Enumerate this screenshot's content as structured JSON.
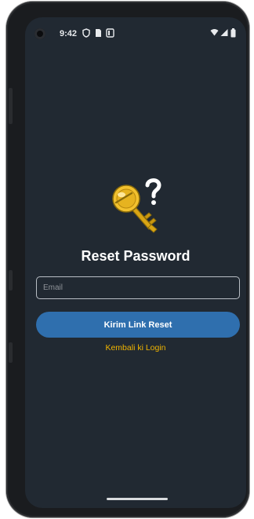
{
  "status_bar": {
    "time": "9:42"
  },
  "reset_form": {
    "title": "Reset Password",
    "email_placeholder": "Email",
    "email_value": "",
    "submit_label": "Kirim Link Reset",
    "back_link": "Kembali ki Login"
  },
  "colors": {
    "background": "#212932",
    "primary_button": "#2f6fae",
    "link": "#f0b400",
    "title_text": "#ffffff"
  },
  "icons": {
    "status_left": [
      "vpn-icon",
      "sim-icon",
      "screen-cast-icon"
    ],
    "status_right": [
      "wifi-icon",
      "signal-icon",
      "battery-icon"
    ],
    "hero": "key-question-icon"
  }
}
